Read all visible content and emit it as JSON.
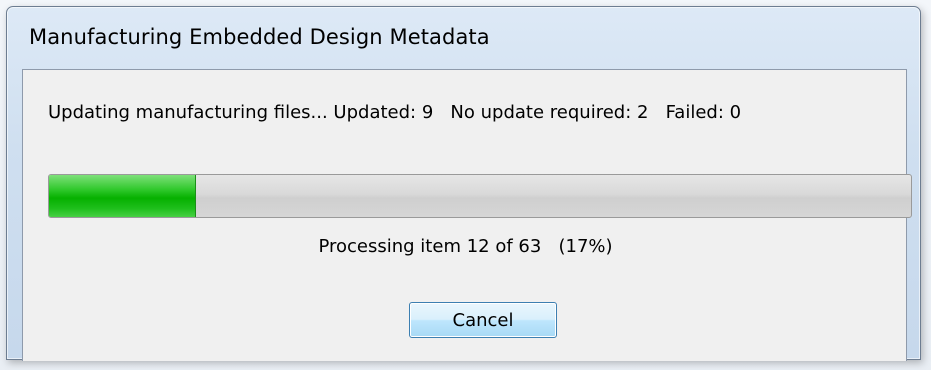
{
  "window": {
    "title": "Manufacturing Embedded Design Metadata"
  },
  "status": {
    "text": "Updating manufacturing files... Updated: 9   No update required: 2   Failed: 0"
  },
  "progress": {
    "current": 12,
    "total": 63,
    "fraction": 0.17,
    "text": "Processing item 12 of 63   (17%)",
    "fill_color": "#06b000"
  },
  "buttons": {
    "cancel_label": "Cancel"
  }
}
